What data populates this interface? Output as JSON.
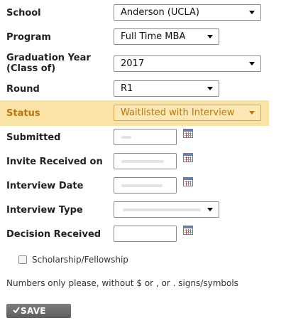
{
  "form": {
    "school": {
      "label": "School",
      "value": "Anderson (UCLA)"
    },
    "program": {
      "label": "Program",
      "value": "Full Time MBA"
    },
    "graduation_year": {
      "label": "Graduation Year\n(Class of)",
      "value": "2017"
    },
    "round": {
      "label": "Round",
      "value": "R1"
    },
    "status": {
      "label": "Status",
      "value": "Waitlisted with Interview",
      "highlight_color": "#fbe3a7"
    },
    "submitted": {
      "label": "Submitted",
      "value": ""
    },
    "invite_received": {
      "label": "Invite Received on",
      "value": ""
    },
    "interview_date": {
      "label": "Interview Date",
      "value": ""
    },
    "interview_type": {
      "label": "Interview Type",
      "value": ""
    },
    "decision_received": {
      "label": "Decision Received",
      "value": ""
    },
    "scholarship": {
      "label": "Scholarship/Fellowship",
      "checked": false
    },
    "note": "Numbers only please, without $ or , or . signs/symbols",
    "save_label": "SAVE"
  },
  "icons": {
    "calendar": "calendar-icon",
    "dropdown": "chevron-down-icon",
    "save_check": "checkmark-icon"
  }
}
